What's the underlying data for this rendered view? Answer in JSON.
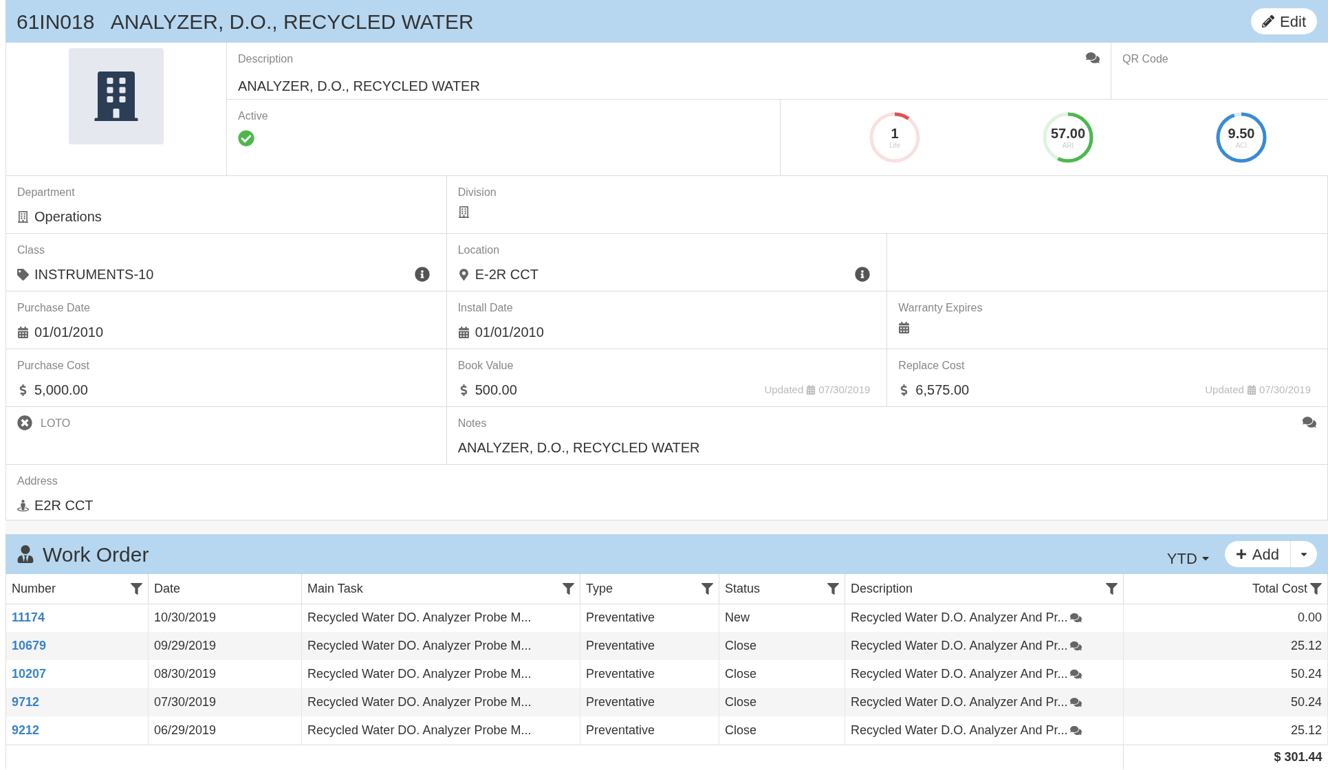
{
  "header": {
    "title": "61IN018   ANALYZER, D.O., RECYCLED WATER",
    "edit_button": "Edit"
  },
  "description": {
    "label": "Description",
    "value": "ANALYZER, D.O., RECYCLED WATER"
  },
  "qr_code": {
    "label": "QR Code"
  },
  "active": {
    "label": "Active",
    "checked": true
  },
  "gauges": [
    {
      "value": "1",
      "caption": "Life",
      "color": "#e05252"
    },
    {
      "value": "57.00",
      "caption": "ARI",
      "color": "#4cb84c"
    },
    {
      "value": "9.50",
      "caption": "ACI",
      "color": "#3a8ad6"
    }
  ],
  "field_rows": [
    [
      {
        "kind": "organization",
        "label": "Department",
        "value": "Operations"
      },
      {
        "kind": "organization",
        "label": "Division"
      }
    ],
    [
      {
        "kind": "category",
        "label": "Class",
        "value": "INSTRUMENTS-10",
        "info": true
      },
      {
        "kind": "place",
        "label": "Location",
        "value": "E-2R CCT",
        "info": true
      },
      {
        "kind": "empty"
      }
    ],
    [
      {
        "kind": "date",
        "label": "Purchase Date",
        "value": "01/01/2010"
      },
      {
        "kind": "date",
        "label": "Install Date",
        "value": "01/01/2010"
      },
      {
        "kind": "date",
        "label": "Warranty Expires"
      }
    ],
    [
      {
        "kind": "money",
        "label": "Purchase Cost",
        "value": "5,000.00"
      },
      {
        "kind": "money",
        "label": "Book Value",
        "value": "500.00",
        "updated_label": "Updated",
        "updated_date": "07/30/2019"
      },
      {
        "kind": "money",
        "label": "Replace Cost",
        "value": "6,575.00",
        "updated_label": "Updated",
        "updated_date": "07/30/2019"
      }
    ],
    [
      {
        "kind": "flag",
        "label": "LOTO",
        "checked": false
      },
      {
        "kind": "text",
        "label": "Notes",
        "value": "ANALYZER, D.O., RECYCLED WATER",
        "comment": true
      }
    ],
    [
      {
        "kind": "address",
        "label": "Address",
        "value": "E2R CCT"
      }
    ]
  ],
  "work_order": {
    "title": "Work Order",
    "period": "YTD",
    "add_button": "Add",
    "columns": [
      {
        "label": "Number",
        "filter": true
      },
      {
        "label": "Date",
        "filter": false
      },
      {
        "label": "Main Task",
        "filter": true
      },
      {
        "label": "Type",
        "filter": true
      },
      {
        "label": "Status",
        "filter": true
      },
      {
        "label": "Description",
        "filter": true
      },
      {
        "label": "Total Cost",
        "filter": true
      }
    ],
    "rows": [
      [
        "11174",
        "10/30/2019",
        "Recycled Water DO. Analyzer Probe M...",
        "Preventative",
        "New",
        "Recycled Water D.O. Analyzer And Pr...",
        "0.00"
      ],
      [
        "10679",
        "09/29/2019",
        "Recycled Water DO. Analyzer Probe M...",
        "Preventative",
        "Close",
        "Recycled Water D.O. Analyzer And Pr...",
        "25.12"
      ],
      [
        "10207",
        "08/30/2019",
        "Recycled Water DO. Analyzer Probe M...",
        "Preventative",
        "Close",
        "Recycled Water D.O. Analyzer And Pr...",
        "50.24"
      ],
      [
        "9712",
        "07/30/2019",
        "Recycled Water DO. Analyzer Probe M...",
        "Preventative",
        "Close",
        "Recycled Water D.O. Analyzer And Pr...",
        "50.24"
      ],
      [
        "9212",
        "06/29/2019",
        "Recycled Water DO. Analyzer Probe M...",
        "Preventative",
        "Close",
        "Recycled Water D.O. Analyzer And Pr...",
        "25.12"
      ]
    ],
    "total_currency": "$",
    "total": "301.44"
  }
}
